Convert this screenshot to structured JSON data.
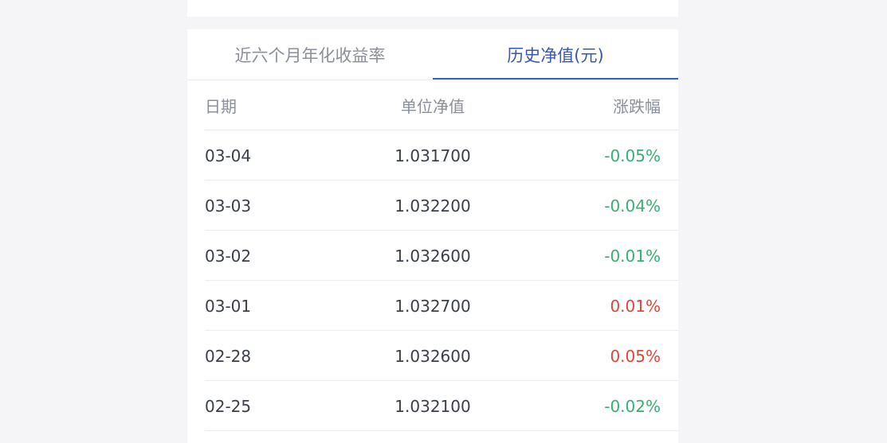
{
  "tabs": [
    {
      "label": "近六个月年化收益率",
      "active": false
    },
    {
      "label": "历史净值(元)",
      "active": true
    }
  ],
  "table": {
    "headers": {
      "date": "日期",
      "nav": "单位净值",
      "change": "涨跌幅"
    },
    "rows": [
      {
        "date": "03-04",
        "nav": "1.031700",
        "change": "-0.05%",
        "direction": "down"
      },
      {
        "date": "03-03",
        "nav": "1.032200",
        "change": "-0.04%",
        "direction": "down"
      },
      {
        "date": "03-02",
        "nav": "1.032600",
        "change": "-0.01%",
        "direction": "down"
      },
      {
        "date": "03-01",
        "nav": "1.032700",
        "change": "0.01%",
        "direction": "up"
      },
      {
        "date": "02-28",
        "nav": "1.032600",
        "change": "0.05%",
        "direction": "up"
      },
      {
        "date": "02-25",
        "nav": "1.032100",
        "change": "-0.02%",
        "direction": "down"
      }
    ]
  },
  "colors": {
    "accent": "#3b5fc4",
    "up": "#d9483b",
    "down": "#3aae73",
    "muted": "#8a8f99"
  }
}
